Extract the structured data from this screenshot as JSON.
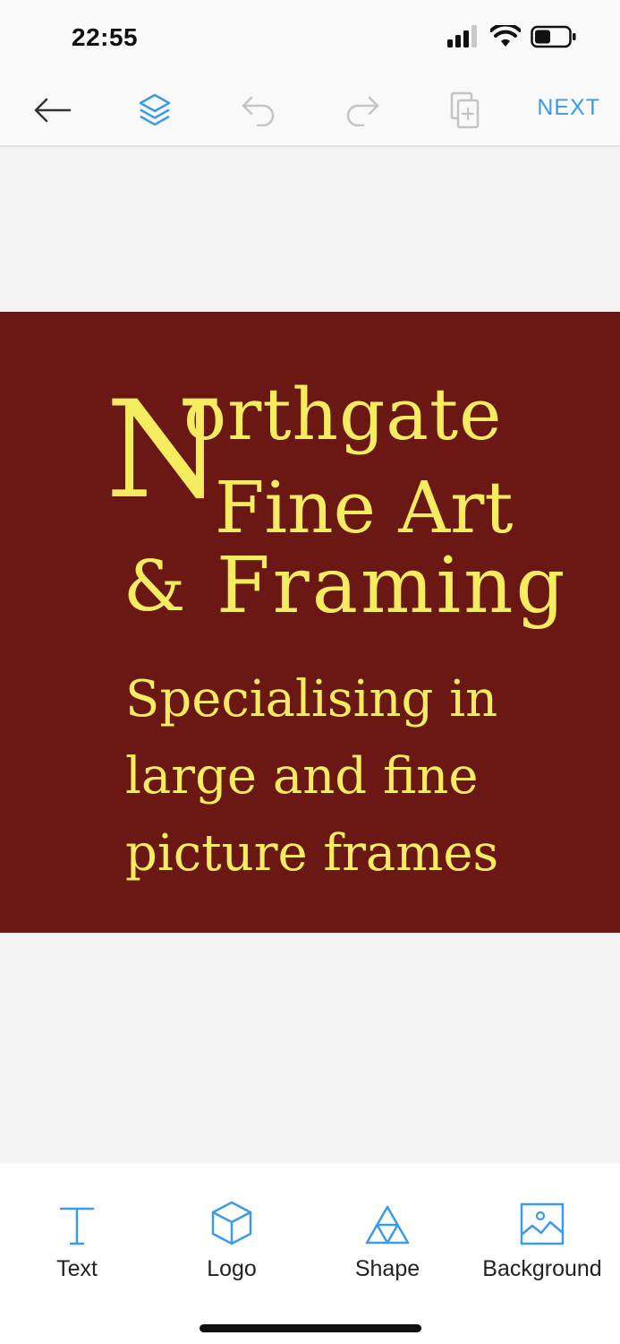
{
  "status": {
    "time": "22:55",
    "icons": [
      "signal-icon",
      "wifi-icon",
      "battery-icon"
    ]
  },
  "toolbar": {
    "back_icon": "arrow-left-icon",
    "layers_icon": "layers-icon",
    "undo_icon": "undo-icon",
    "redo_icon": "redo-icon",
    "duplicate_icon": "add-page-icon",
    "next_label": "NEXT"
  },
  "design": {
    "background_color": "#6b1714",
    "text_color": "#f5ec5f",
    "line1_initial": "N",
    "line1_rest": "orthgate",
    "line2": "Fine Art",
    "line3_amp": "&",
    "line3_rest": "Framing",
    "subtitle_lines": [
      "Specialising in",
      "large and fine",
      "picture frames"
    ]
  },
  "tools": [
    {
      "label": "Text",
      "icon": "text-icon"
    },
    {
      "label": "Logo",
      "icon": "cube-icon"
    },
    {
      "label": "Shape",
      "icon": "triangles-icon"
    },
    {
      "label": "Background",
      "icon": "image-icon"
    }
  ],
  "colors": {
    "accent": "#3b9be8",
    "disabled": "#c4c4c4"
  }
}
